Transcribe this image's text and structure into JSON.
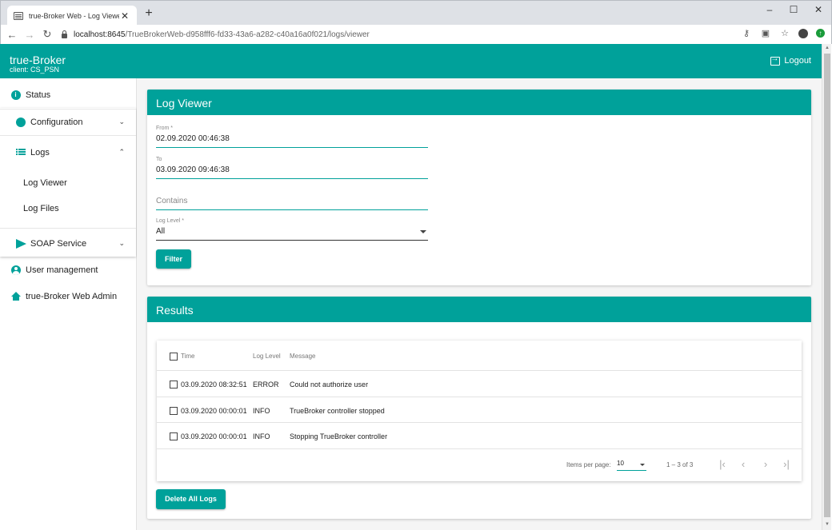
{
  "browser": {
    "tab_title": "true-Broker Web - Log Viewer",
    "url_host": "localhost:8645",
    "url_path": "/TrueBrokerWeb-d958fff6-fd33-43a6-a282-c40a16a0f021/logs/viewer"
  },
  "header": {
    "brand": "true-Broker",
    "client": "client: CS_PSN",
    "logout_label": "Logout"
  },
  "sidebar": {
    "status": "Status",
    "configuration": "Configuration",
    "logs": "Logs",
    "log_viewer": "Log Viewer",
    "log_files": "Log Files",
    "soap_service": "SOAP Service",
    "user_management": "User management",
    "web_admin": "true-Broker Web Admin"
  },
  "log_viewer": {
    "title": "Log Viewer",
    "from_label": "From *",
    "from_value": "02.09.2020 00:46:38",
    "to_label": "To",
    "to_value": "03.09.2020 09:46:38",
    "contains_placeholder": "Contains",
    "level_label": "Log Level *",
    "level_value": "All",
    "filter_button": "Filter"
  },
  "results": {
    "title": "Results",
    "columns": {
      "time": "Time",
      "level": "Log Level",
      "message": "Message"
    },
    "rows": [
      {
        "time": "03.09.2020 08:32:51",
        "level": "ERROR",
        "message": "Could not authorize user"
      },
      {
        "time": "03.09.2020 00:00:01",
        "level": "INFO",
        "message": "TrueBroker controller stopped"
      },
      {
        "time": "03.09.2020 00:00:01",
        "level": "INFO",
        "message": "Stopping TrueBroker controller"
      }
    ],
    "paginator": {
      "items_per_page_label": "Items per page:",
      "page_size": "10",
      "range": "1 – 3 of 3"
    },
    "delete_button": "Delete All Logs"
  },
  "colors": {
    "accent": "#00a19a"
  }
}
